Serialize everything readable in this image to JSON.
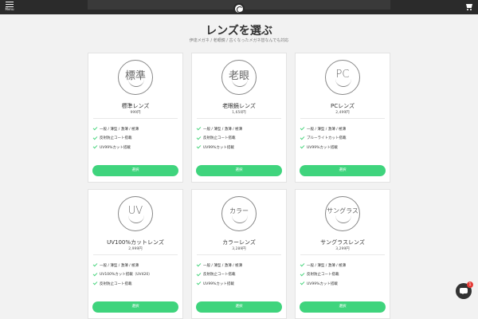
{
  "header": {
    "menu_label": "Menu",
    "icons": {
      "menu": "hamburger-icon",
      "logo": "logo-circle-arrow",
      "cart": "cart-icon"
    }
  },
  "page": {
    "title": "レンズを選ぶ",
    "subtitle": "伊達メガネ / 老眼鏡 / 古くなったメガネ替なんでも対応"
  },
  "colors": {
    "accent": "#3fd47d",
    "check": "#4cd580",
    "header_bg": "#2b2b2b",
    "badge": "#e53935"
  },
  "cards": [
    {
      "icon_text": "標準",
      "name": "標準レンズ",
      "price": "999円",
      "features": [
        "一般 / 薄型 / 激薄 / 極薄",
        "反射防止コート搭載",
        "UV99%カット搭載"
      ],
      "button": "選択"
    },
    {
      "icon_text": "老眼",
      "name": "老眼鏡レンズ",
      "price": "1,650円",
      "features": [
        "一般 / 薄型 / 激薄 / 極薄",
        "反射防止コート搭載",
        "UV99%カット搭載"
      ],
      "button": "選択"
    },
    {
      "icon_text": "PC",
      "name": "PCレンズ",
      "price": "2,499円",
      "features": [
        "一般 / 薄型 / 激薄 / 極薄",
        "ブルーライトカット搭載",
        "UV99%カット搭載"
      ],
      "button": "選択"
    },
    {
      "icon_text": "UV",
      "name": "UV100%カットレンズ",
      "price": "2,999円",
      "features": [
        "一般 / 薄型 / 激薄 / 極薄",
        "UV100%カット搭載（UV420）",
        "反射防止コート搭載"
      ],
      "button": "選択"
    },
    {
      "icon_text": "カラー",
      "name": "カラーレンズ",
      "price": "3,289円",
      "features": [
        "一般 / 薄型 / 激薄 / 極薄",
        "反射防止コート搭載",
        "UV99%カット搭載"
      ],
      "button": "選択"
    },
    {
      "icon_text": "サングラス",
      "name": "サングラスレンズ",
      "price": "3,299円",
      "features": [
        "一般 / 薄型 / 激薄 / 極薄",
        "反射防止コート搭載",
        "UV99%カット搭載"
      ],
      "button": "選択"
    }
  ],
  "chat": {
    "badge_count": "1"
  }
}
